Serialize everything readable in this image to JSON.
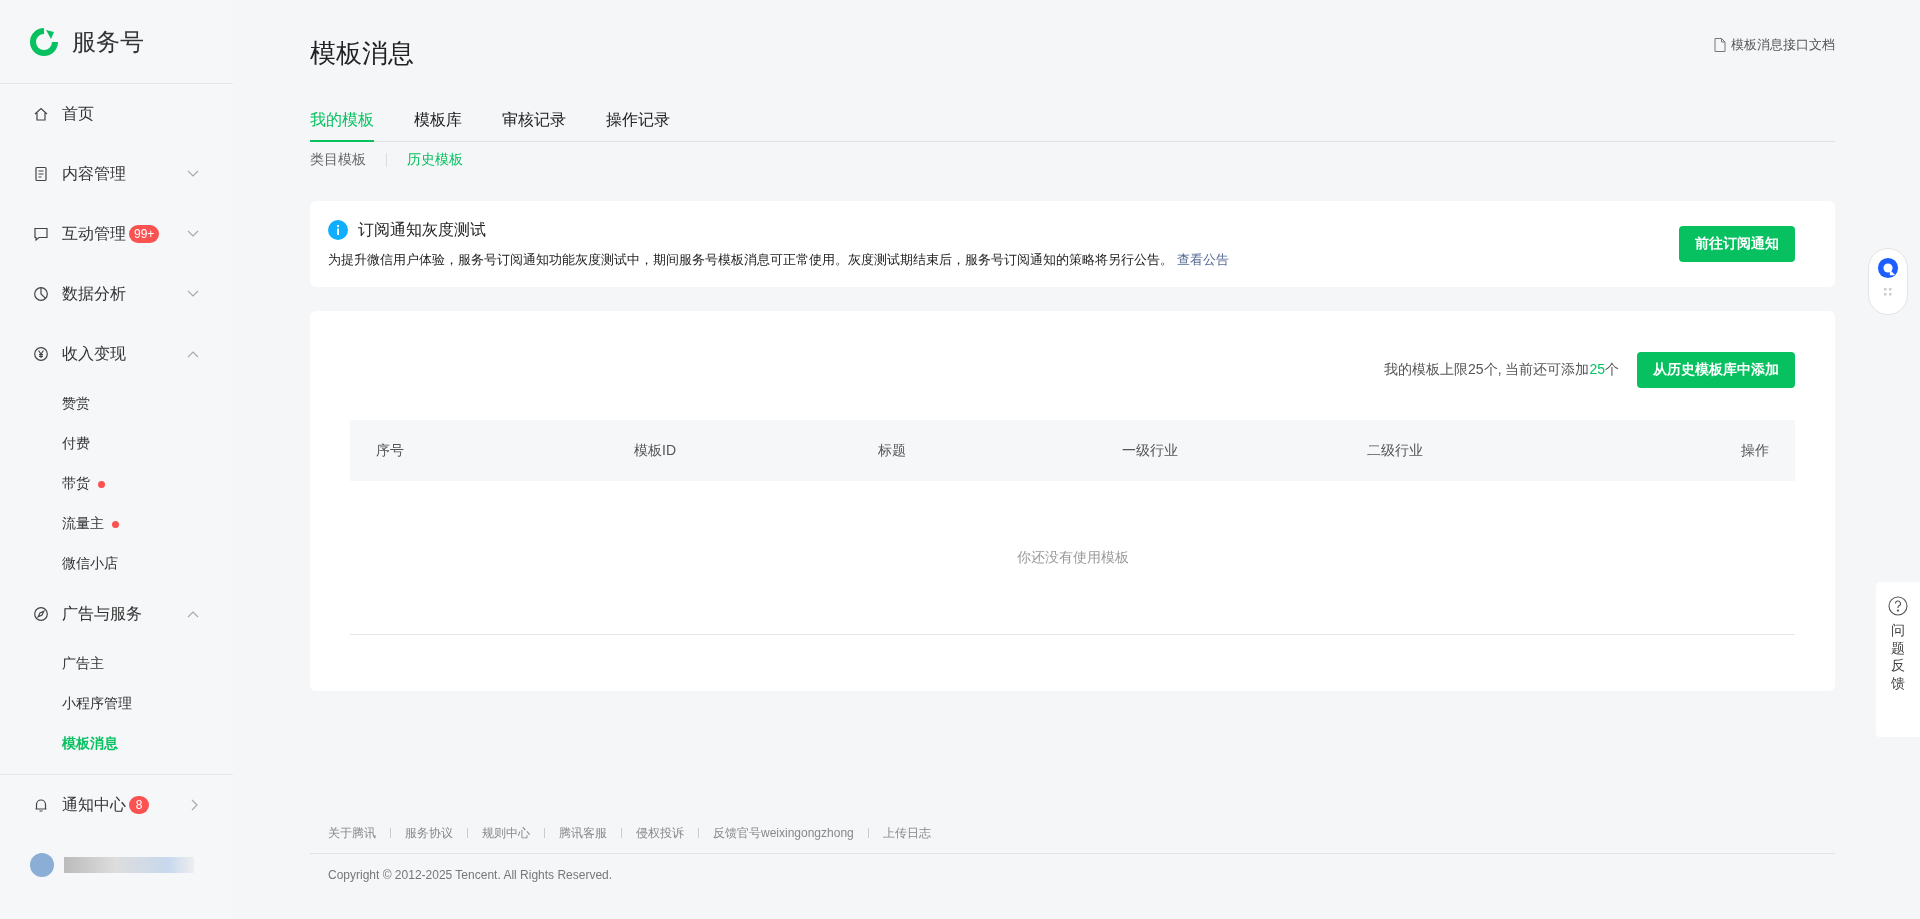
{
  "sidebar": {
    "brand": "服务号",
    "items": [
      {
        "kind": "plain",
        "label": "首页"
      },
      {
        "kind": "group",
        "label": "内容管理",
        "expanded": false
      },
      {
        "kind": "group",
        "label": "互动管理",
        "expanded": false,
        "badge": "99+"
      },
      {
        "kind": "group",
        "label": "数据分析",
        "expanded": false
      },
      {
        "kind": "group",
        "label": "收入变现",
        "expanded": true,
        "children": [
          {
            "label": "赞赏",
            "selected": false,
            "dot": false
          },
          {
            "label": "付费",
            "selected": false,
            "dot": false
          },
          {
            "label": "带货",
            "selected": false,
            "dot": true
          },
          {
            "label": "流量主",
            "selected": false,
            "dot": true
          },
          {
            "label": "微信小店",
            "selected": false,
            "dot": false
          }
        ]
      },
      {
        "kind": "group",
        "label": "广告与服务",
        "expanded": true,
        "children": [
          {
            "label": "广告主",
            "selected": false,
            "dot": false
          },
          {
            "label": "小程序管理",
            "selected": false,
            "dot": false
          },
          {
            "label": "模板消息",
            "selected": true,
            "dot": false
          }
        ]
      }
    ],
    "notice": {
      "label": "通知中心",
      "badge": "8"
    }
  },
  "page": {
    "title": "模板消息",
    "doc_link": "模板消息接口文档",
    "tabs": [
      {
        "label": "我的模板",
        "selected": true
      },
      {
        "label": "模板库",
        "selected": false
      },
      {
        "label": "审核记录",
        "selected": false
      },
      {
        "label": "操作记录",
        "selected": false
      }
    ],
    "subtabs": [
      {
        "label": "类目模板",
        "selected": false
      },
      {
        "label": "历史模板",
        "selected": true
      }
    ],
    "banner": {
      "title": "订阅通知灰度测试",
      "text": "为提升微信用户体验，服务号订阅通知功能灰度测试中，期间服务号模板消息可正常使用。灰度测试期结束后，服务号订阅通知的策略将另行公告。",
      "link": "查看公告",
      "button": "前往订阅通知"
    },
    "quota": {
      "prefix": "我的模板上限25个, 当前还可添加",
      "count": "25",
      "suffix": "个"
    },
    "add_button": "从历史模板库中添加",
    "table": {
      "columns": [
        "序号",
        "模板ID",
        "标题",
        "一级行业",
        "二级行业",
        "操作"
      ],
      "empty": "你还没有使用模板"
    }
  },
  "footer": {
    "links": [
      "关于腾讯",
      "服务协议",
      "规则中心",
      "腾讯客服",
      "侵权投诉",
      "反馈官号weixingongzhong",
      "上传日志"
    ],
    "copyright": "Copyright © 2012-2025 Tencent. All Rights Reserved."
  },
  "feedback": "问题反馈"
}
